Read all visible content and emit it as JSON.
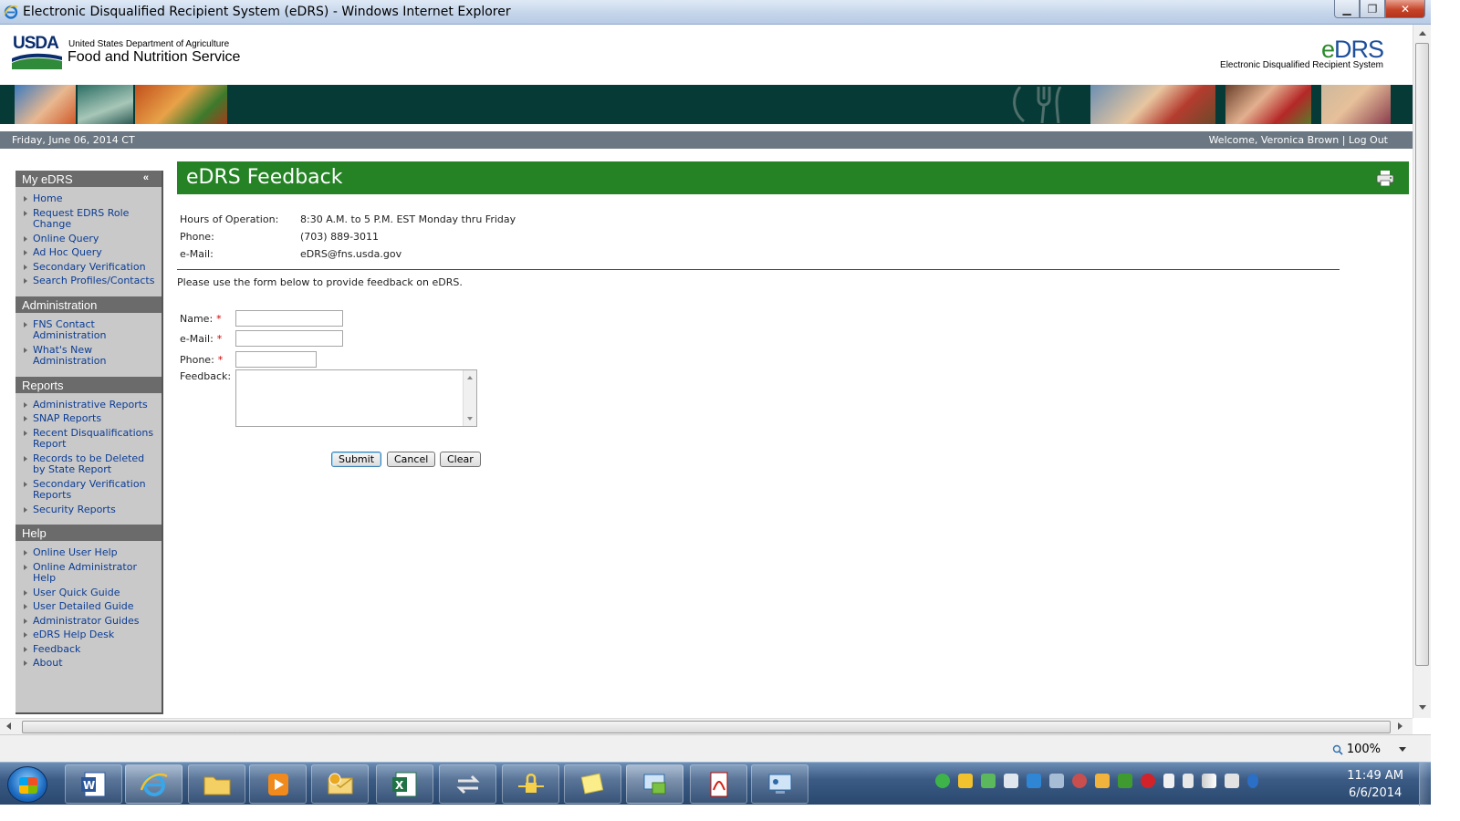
{
  "window": {
    "title": "Electronic Disqualified Recipient System (eDRS) - Windows Internet Explorer",
    "minimize": "▁",
    "maximize": "❐",
    "close": "✕"
  },
  "header": {
    "usda": "USDA",
    "department": "United States Department of Agriculture",
    "agency": "Food and Nutrition Service",
    "app_logo_e": "e",
    "app_logo_rest": "DRS",
    "app_subtitle": "Electronic Disqualified Recipient System"
  },
  "datebar": {
    "date": "Friday, June 06, 2014 CT",
    "welcome": "Welcome, Veronica Brown",
    "separator": "|",
    "logout": "Log Out"
  },
  "sidebar": {
    "collapse_glyph": "«",
    "sections": [
      {
        "title": "My eDRS",
        "items": [
          "Home",
          "Request EDRS Role Change",
          "Online Query",
          "Ad Hoc Query",
          "Secondary Verification",
          "Search Profiles/Contacts"
        ]
      },
      {
        "title": "Administration",
        "items": [
          "FNS Contact Administration",
          "What's New Administration"
        ]
      },
      {
        "title": "Reports",
        "items": [
          "Administrative Reports",
          "SNAP Reports",
          "Recent Disqualifications Report",
          "Records to be Deleted by State Report",
          "Secondary Verification Reports",
          "Security Reports"
        ]
      },
      {
        "title": "Help",
        "items": [
          "Online User Help",
          "Online Administrator Help",
          "User Quick Guide",
          "User Detailed Guide",
          "Administrator Guides",
          "eDRS Help Desk",
          "Feedback",
          "About"
        ]
      }
    ]
  },
  "content": {
    "title": "eDRS Feedback",
    "info": {
      "hours_label": "Hours of Operation:",
      "hours_value": "8:30 A.M. to 5 P.M. EST Monday thru Friday",
      "phone_label": "Phone:",
      "phone_value": "(703) 889-3011",
      "email_label": "e-Mail:",
      "email_value": "eDRS@fns.usda.gov"
    },
    "intro": "Please use the form below to provide feedback on eDRS.",
    "form": {
      "name_label": "Name:",
      "email_label": "e-Mail:",
      "phone_label": "Phone:",
      "feedback_label": "Feedback:",
      "required_mark": "*",
      "name_value": "",
      "email_value": "",
      "phone_value": "",
      "feedback_value": "",
      "submit": "Submit",
      "cancel": "Cancel",
      "clear": "Clear"
    }
  },
  "statusbar": {
    "zoom": "100%"
  },
  "taskbar": {
    "time": "11:49 AM",
    "date": "6/6/2014"
  }
}
